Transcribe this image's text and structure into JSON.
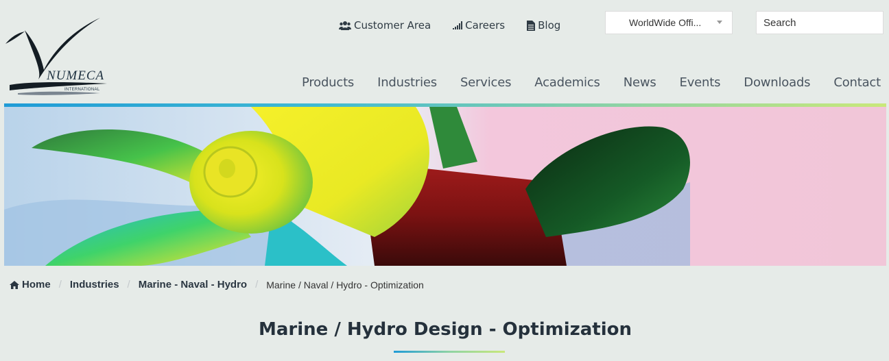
{
  "logo": {
    "name": "NUMECA",
    "subtitle": "INTERNATIONAL"
  },
  "top_links": [
    {
      "label": "Customer Area",
      "icon": "users-icon"
    },
    {
      "label": "Careers",
      "icon": "signal-bars-icon"
    },
    {
      "label": "Blog",
      "icon": "document-icon"
    }
  ],
  "office_select": {
    "value": "WorldWide Offi..."
  },
  "search": {
    "placeholder": "Search"
  },
  "nav": [
    "Products",
    "Industries",
    "Services",
    "Academics",
    "News",
    "Events",
    "Downloads",
    "Contact"
  ],
  "breadcrumb": {
    "home": "Home",
    "items": [
      "Industries",
      "Marine - Naval - Hydro"
    ],
    "current": "Marine / Naval / Hydro - Optimization"
  },
  "page_title": "Marine / Hydro Design - Optimization",
  "colors": {
    "accent_start": "#1f9bd6",
    "accent_end": "#c9e87a",
    "text_dark": "#25313c",
    "background": "#e6ebe8"
  }
}
